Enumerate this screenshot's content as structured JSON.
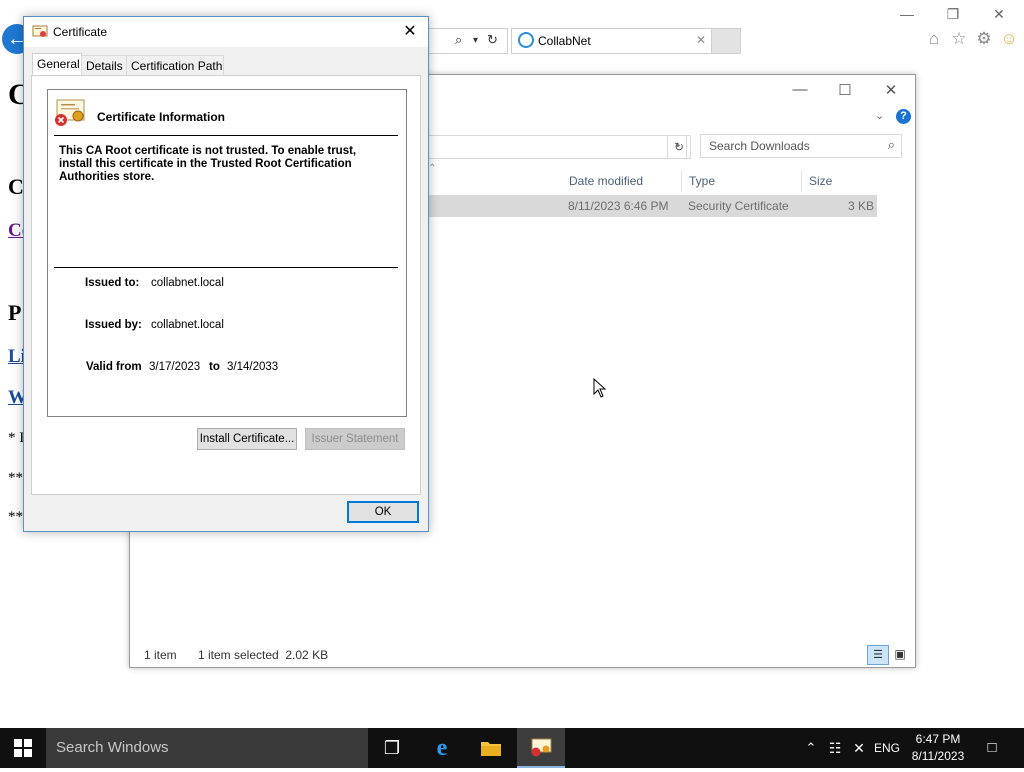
{
  "browser": {
    "tab_title": "CollabNet",
    "window_controls": {
      "minimize": "—",
      "restore": "❐",
      "close": "✕"
    },
    "tool_icons": [
      "home-icon",
      "star-icon",
      "gear-icon",
      "smiley-icon"
    ]
  },
  "background_page": {
    "fragments": [
      "C",
      "C",
      "Co",
      "P",
      "Li",
      "W",
      "* I",
      "**",
      "**"
    ]
  },
  "explorer": {
    "search_placeholder": "Search Downloads",
    "columns": [
      "Date modified",
      "Type",
      "Size"
    ],
    "selected_row": {
      "date_modified": "8/11/2023 6:46 PM",
      "type": "Security Certificate",
      "size": "3 KB"
    },
    "status_items": "1 item",
    "status_selected": "1 item selected  2.02 KB"
  },
  "certificate_dialog": {
    "title": "Certificate",
    "tabs": [
      "General",
      "Details",
      "Certification Path"
    ],
    "active_tab": "General",
    "info_title": "Certificate Information",
    "warning_text": "This CA Root certificate is not trusted. To enable trust, install this certificate in the Trusted Root Certification Authorities store.",
    "issued_to_label": "Issued to:",
    "issued_to_value": "collabnet.local",
    "issued_by_label": "Issued by:",
    "issued_by_value": "collabnet.local",
    "valid_from_label": "Valid from",
    "valid_from_value": "3/17/2023",
    "valid_to_label": "to",
    "valid_to_value": "3/14/2033",
    "install_button": "Install Certificate...",
    "issuer_statement_button": "Issuer Statement",
    "ok_button": "OK"
  },
  "taskbar": {
    "search_placeholder": "Search Windows",
    "language": "ENG",
    "time": "6:47 PM",
    "date": "8/11/2023"
  },
  "colors": {
    "accent": "#0078d7",
    "ie_blue": "#1e78d2",
    "taskbar": "#101010"
  }
}
